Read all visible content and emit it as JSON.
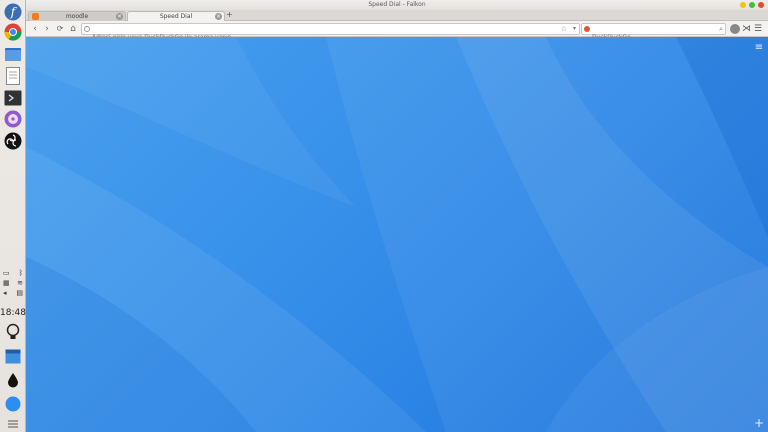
{
  "window": {
    "title": "Speed Dial - Falkon",
    "controls": {
      "minimize_color": "#f5c211",
      "maximize_color": "#3cc13c",
      "close_color": "#e8482c"
    }
  },
  "tabs": [
    {
      "label": "moodle",
      "active": false
    },
    {
      "label": "Speed Dial",
      "active": true
    }
  ],
  "new_tab_label": "+",
  "navbar": {
    "back_icon": "‹",
    "forward_icon": "›",
    "reload_icon": "⟳",
    "home_icon": "⌂",
    "url_placeholder": "Adresi girin veya DuckDuckGo ile arama yapın",
    "search_placeholder": "DuckDuckGo",
    "bookmark_icon": "☆",
    "dropdown_icon": "▾"
  },
  "dock": {
    "apps": [
      {
        "name": "fedora-icon",
        "color": "#3c6eb4"
      },
      {
        "name": "chrome-icon",
        "color": "#4285f4"
      },
      {
        "name": "files-icon",
        "color": "#3a7bd5"
      },
      {
        "name": "document-icon",
        "color": "#ffffff"
      },
      {
        "name": "terminal-icon",
        "color": "#2e3436"
      },
      {
        "name": "music-icon",
        "color": "#8e5bd0"
      },
      {
        "name": "obs-icon",
        "color": "#111111"
      }
    ],
    "clock": "18:48"
  },
  "content": {
    "background_colors": [
      "#4aa0ee",
      "#1b73dc"
    ],
    "menu_icon": "≡",
    "add_icon": "+"
  }
}
